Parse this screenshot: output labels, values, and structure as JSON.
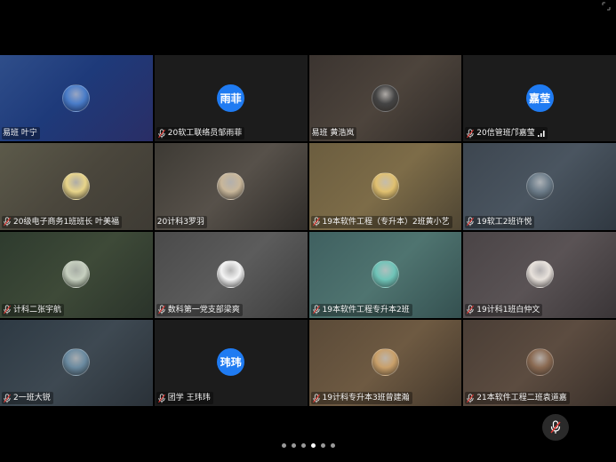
{
  "participants": [
    {
      "name": "易班 叶宁",
      "avatar_text": "",
      "muted": false,
      "bg": "linear-gradient(135deg,#2f4e8a 0%,#1e3a7a 45%,#2a2e66 100%)",
      "avatar_bg": "#4a7dc9"
    },
    {
      "name": "20软工联络员邹雨菲",
      "avatar_text": "雨菲",
      "muted": true,
      "bg": "#1c1c1c"
    },
    {
      "name": "易班 黄浩岚",
      "avatar_text": "",
      "muted": false,
      "bg": "linear-gradient(135deg,#3b3430 0%,#4d443c 50%,#2f2a27 100%)",
      "avatar_bg": "#444"
    },
    {
      "name": "20信管班邝嘉莹",
      "avatar_text": "嘉莹",
      "muted": true,
      "signal": true,
      "bg": "#1c1c1c"
    },
    {
      "name": "20级电子商务1班班长 叶美福",
      "avatar_text": "",
      "muted": true,
      "bg": "linear-gradient(135deg,#5c5a4a 0%,#4a463c 50%,#3e3b34 100%)",
      "avatar_bg": "#e9d58a"
    },
    {
      "name": "20计科3罗羽",
      "avatar_text": "",
      "muted": false,
      "bg": "linear-gradient(135deg,#3d3a34 0%,#57514a 50%,#2f2c29 100%)",
      "avatar_bg": "#c9b79a"
    },
    {
      "name": "19本软件工程（专升本）2班黄小艺",
      "avatar_text": "",
      "muted": true,
      "bg": "linear-gradient(135deg,#6b5d3f 0%,#7d6c48 50%,#4e4533 100%)",
      "avatar_bg": "#e0c070"
    },
    {
      "name": "19软工2班许悦",
      "avatar_text": "",
      "muted": true,
      "bg": "linear-gradient(135deg,#3d4650 0%,#4a5560 50%,#303841 100%)",
      "avatar_bg": "#6d7d8a"
    },
    {
      "name": "计科二张宇航",
      "avatar_text": "",
      "muted": true,
      "bg": "linear-gradient(135deg,#2e3b2e 0%,#3e4a38 50%,#2a332a 100%)",
      "avatar_bg": "#c7d0c0"
    },
    {
      "name": "数科第一党支部梁爽",
      "avatar_text": "",
      "muted": true,
      "bg": "linear-gradient(135deg,#4a4a4a 0%,#5c5c5c 50%,#3c3c3c 100%)",
      "avatar_bg": "#f4f4f4"
    },
    {
      "name": "19本软件工程专升本2班",
      "avatar_text": "",
      "muted": true,
      "bg": "linear-gradient(135deg,#3f6060 0%,#4f7470 50%,#345050 100%)",
      "avatar_bg": "#6fc4b8"
    },
    {
      "name": "19计科1班白仲文",
      "avatar_text": "",
      "muted": true,
      "bg": "linear-gradient(135deg,#4a4446 0%,#5a5355 50%,#3a3537 100%)",
      "avatar_bg": "#e8e2dc"
    },
    {
      "name": "2一班大锐",
      "avatar_text": "",
      "muted": true,
      "bg": "linear-gradient(135deg,#2e3a44 0%,#3e4952 50%,#2a3138 100%)",
      "avatar_bg": "#6a8aa0"
    },
    {
      "name": "团学 王玮玮",
      "avatar_text": "玮玮",
      "muted": true,
      "bg": "#1c1c1c"
    },
    {
      "name": "19计科专升本3班曾建瀚",
      "avatar_text": "",
      "muted": true,
      "bg": "linear-gradient(135deg,#5a4a38 0%,#6e5a42 50%,#44382c 100%)",
      "avatar_bg": "#c9a06a"
    },
    {
      "name": "21本软件工程二班袁道嘉",
      "avatar_text": "",
      "muted": true,
      "bg": "linear-gradient(135deg,#4a3e36 0%,#5c4c40 50%,#3a302a 100%)",
      "avatar_bg": "#8a6a52"
    }
  ],
  "pager": {
    "count": 6,
    "active_index": 3
  },
  "colors": {
    "accent": "#1f7bf2",
    "background": "#000000"
  }
}
